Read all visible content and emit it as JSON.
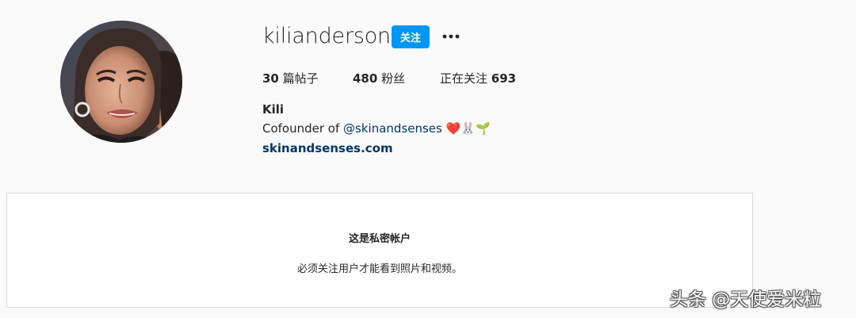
{
  "profile": {
    "username": "kilianderson",
    "follow_label": "关注",
    "more_icon": "more-horizontal-icon",
    "avatar_icon": "profile-photo"
  },
  "stats": {
    "posts_count": "30",
    "posts_label": "篇帖子",
    "followers_count": "480",
    "followers_label": "粉丝",
    "following_label": "正在关注",
    "following_count": "693"
  },
  "bio": {
    "full_name": "Kili",
    "text_prefix": "Cofounder of ",
    "mention": "@skinandsenses",
    "emojis": "❤️🐰🌱",
    "website": "skinandsenses.com"
  },
  "private_account": {
    "title": "这是私密帐户",
    "description": "必须关注用户才能看到照片和视频。"
  },
  "watermark": {
    "text": "头条 @天使爱米粒"
  },
  "colors": {
    "follow_button": "#0095f6",
    "link": "#00376b",
    "background": "#fafafa",
    "text": "#262626",
    "border": "#dbdbdb"
  }
}
